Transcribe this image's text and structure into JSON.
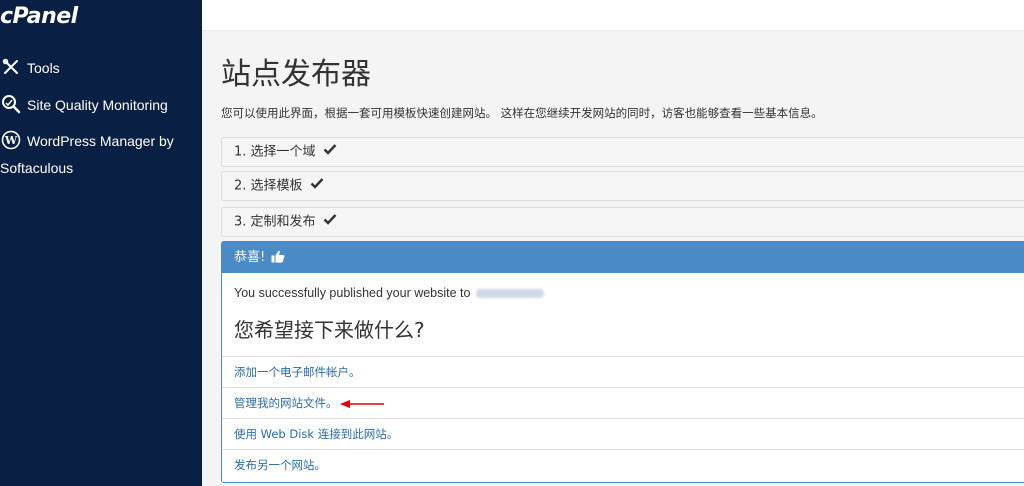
{
  "sidebar": {
    "logo": "cPanel",
    "items": [
      {
        "label": "Tools",
        "icon": "tools-icon"
      },
      {
        "label": "Site Quality Monitoring",
        "icon": "site-quality-icon"
      },
      {
        "label": "WordPress Manager by",
        "label2": "Softaculous",
        "icon": "wordpress-icon"
      }
    ]
  },
  "main": {
    "title": "站点发布器",
    "description": "您可以使用此界面，根据一套可用模板快速创建网站。 这样在您继续开发网站的同时，访客也能够查看一些基本信息。",
    "steps": [
      {
        "label": "1. 选择一个域"
      },
      {
        "label": "2. 选择模板"
      },
      {
        "label": "3. 定制和发布"
      }
    ],
    "panel": {
      "heading": "恭喜!",
      "success_message": "You successfully published your website to",
      "question": "您希望接下来做什么?",
      "links": [
        {
          "label": "添加一个电子邮件帐户。"
        },
        {
          "label": "管理我的网站文件。"
        },
        {
          "label": "使用 Web Disk 连接到此网站。"
        },
        {
          "label": "发布另一个网站。"
        }
      ]
    }
  },
  "colors": {
    "sidebar_bg": "#0a1f44",
    "panel_accent": "#4a8ac7",
    "link": "#2b6cb0",
    "annotation_arrow": "#e00000"
  }
}
